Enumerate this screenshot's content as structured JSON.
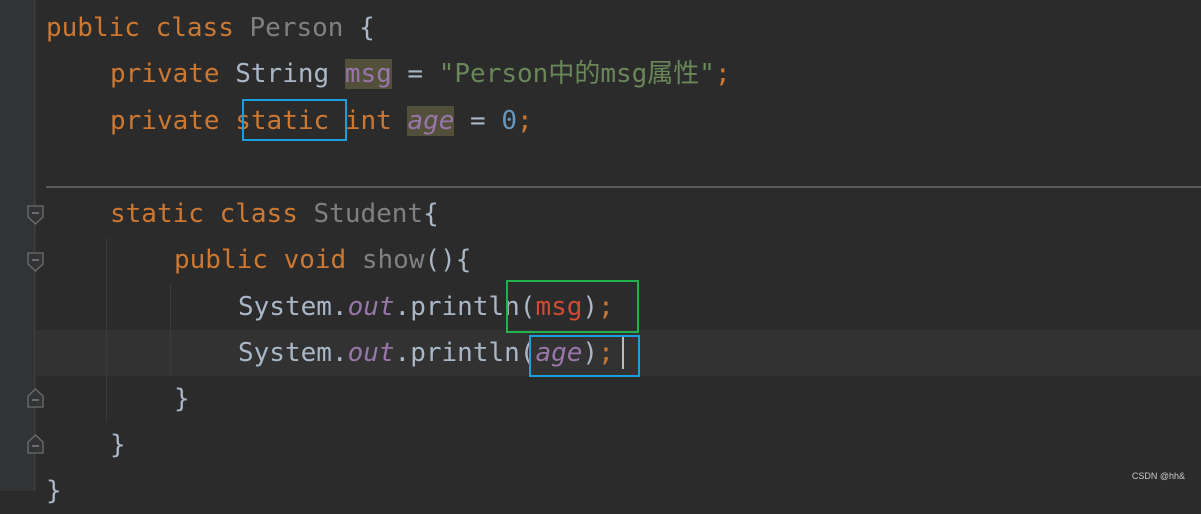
{
  "editor": {
    "lines": [
      {
        "indent": "",
        "kw1": "public",
        "kw2": "class",
        "name": "Person",
        "brace": " {"
      },
      {
        "indent": "    ",
        "kw": "private",
        "type": "String",
        "field": "msg",
        "op": " = ",
        "string": "\"Person中的msg属性\"",
        "semi": ";"
      },
      {
        "indent": "    ",
        "kw": "private",
        "kw_static": "static",
        "type": "int",
        "field": "age",
        "op": " = ",
        "number": "0",
        "semi": ";"
      },
      {
        "indent": "    ",
        "kw1": "static",
        "kw2": "class",
        "name": "Student",
        "brace": "{"
      },
      {
        "indent": "        ",
        "kw1": "public",
        "kw2": "void",
        "name": "show",
        "paren": "()",
        "brace": "{"
      },
      {
        "indent": "            ",
        "system": "System.",
        "out": "out",
        "println": ".println(",
        "arg": "msg",
        "close": ")",
        "semi": ";"
      },
      {
        "indent": "            ",
        "system": "System.",
        "out": "out",
        "println": ".println(",
        "arg": "age",
        "close": ")",
        "semi": ";"
      },
      {
        "indent": "        ",
        "brace": "}"
      },
      {
        "indent": "    ",
        "brace": "}"
      },
      {
        "indent": "",
        "brace": "}"
      }
    ]
  },
  "watermark": "CSDN @hh&",
  "colors": {
    "keyword": "#cc7832",
    "class_name": "#808080",
    "string": "#6a8759",
    "number": "#6897bb",
    "field": "#9876aa",
    "error": "#d04a36",
    "annotation_blue": "#1a9fe0",
    "annotation_green": "#22b14c"
  },
  "icons": [
    "fold-open-icon",
    "fold-close-icon"
  ]
}
